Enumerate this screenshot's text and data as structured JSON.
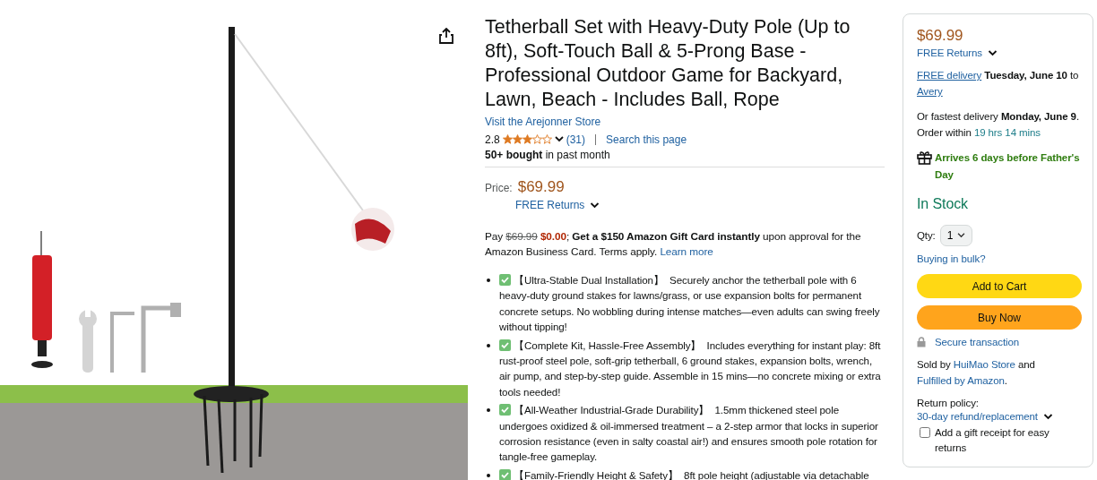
{
  "product": {
    "title": "Tetherball Set with Heavy-Duty Pole (Up to 8ft), Soft-Touch Ball & 5-Prong Base - Professional Outdoor Game for Backyard, Lawn, Beach - Includes Ball, Rope",
    "store_link": "Visit the Arejonner Store",
    "rating": {
      "value": "2.8",
      "stars": 3,
      "count": "(31)",
      "search_link": "Search this page"
    },
    "bought": {
      "bold": "50+ bought",
      "rest": "in past month"
    },
    "price": {
      "label": "Price:",
      "amount": "$69.99",
      "returns": "FREE Returns"
    },
    "offer": {
      "pay": "Pay",
      "old_price": "$69.99",
      "new_price": "$0.00",
      "separator": ";",
      "bold": "Get a $150 Amazon Gift Card instantly",
      "rest": "upon approval for the Amazon Business Card. Terms apply.",
      "link": "Learn more"
    },
    "bullets": [
      {
        "title": "【Ultra-Stable Dual Installation】",
        "text": "Securely anchor the tetherball pole with 6 heavy-duty ground stakes for lawns/grass, or use expansion bolts for permanent concrete setups. No wobbling during intense matches—even adults can swing freely without tipping!"
      },
      {
        "title": "【Complete Kit, Hassle-Free Assembly】",
        "text": "Includes everything for instant play: 8ft rust-proof steel pole, soft-grip tetherball, 6 ground stakes, expansion bolts, wrench, air pump, and step-by-step guide. Assemble in 15 mins—no concrete mixing or extra tools needed!"
      },
      {
        "title": "【All-Weather Industrial-Grade Durability】",
        "text": "1.5mm thickened steel pole undergoes oxidized & oil-immersed treatment – a 2-step armor that locks in superior corrosion resistance (even in salty coastal air!) and ensures smooth pole rotation for tangle-free gameplay."
      },
      {
        "title": "【Family-Friendly Height & Safety】",
        "text": "8ft pole height (adjustable via detachable"
      }
    ]
  },
  "buy_box": {
    "price": "$69.99",
    "returns": "FREE Returns",
    "delivery": {
      "link": "FREE delivery",
      "date": "Tuesday, June 10",
      "to": "to",
      "place": "Avery"
    },
    "fastest": {
      "lead": "Or fastest delivery",
      "date": "Monday, June 9",
      "mid": ". Order within",
      "countdown": "19 hrs 14 mins"
    },
    "gift_note": "Arrives 6 days before Father's Day",
    "stock": "In Stock",
    "qty": {
      "label": "Qty:",
      "value": "1"
    },
    "bulk_link": "Buying in bulk?",
    "add_to_cart": "Add to Cart",
    "buy_now": "Buy Now",
    "secure": "Secure transaction",
    "sold_by": {
      "lead": "Sold by",
      "seller": "HuiMao Store",
      "and": "and",
      "fulfilled": "Fulfilled by Amazon",
      "end": "."
    },
    "return_policy": {
      "label": "Return policy:",
      "link": "30-day refund/replacement"
    },
    "gift_receipt": {
      "label": "Add a gift receipt for easy returns",
      "checked": false
    }
  }
}
